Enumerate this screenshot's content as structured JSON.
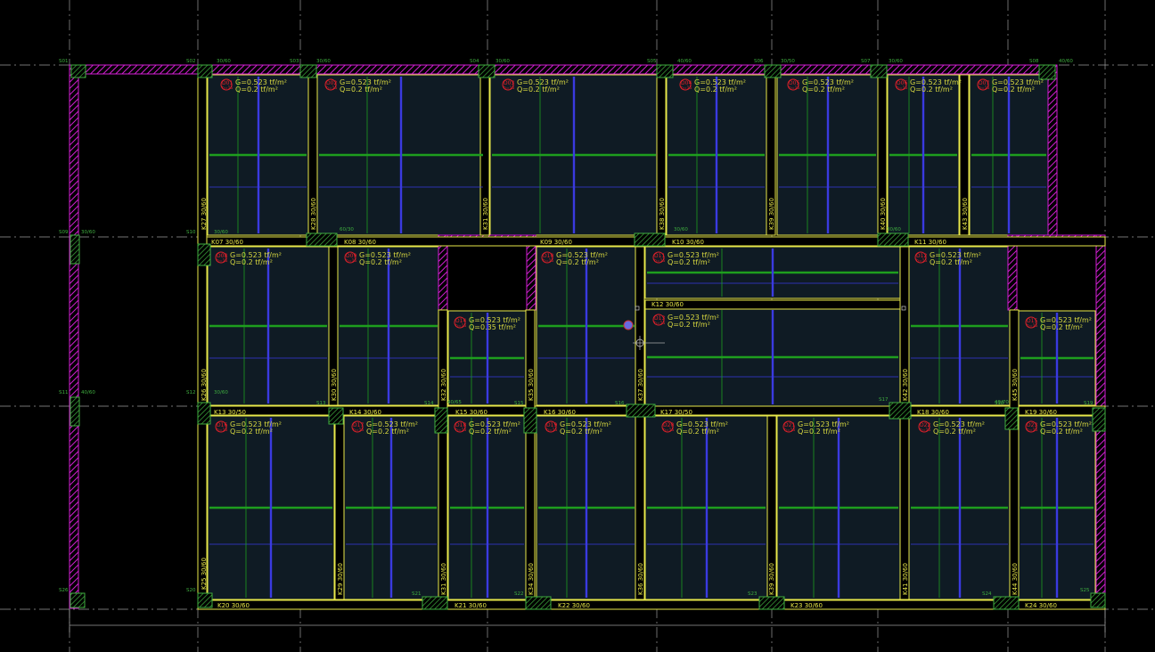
{
  "drawing": {
    "colors": {
      "background": "#000000",
      "grid": "#9a9a9a",
      "slab_fill": "#0f1b24",
      "beam": "#e8e84a",
      "column": "#3fae3f",
      "wall": "#d21ed2",
      "load_text": "#d8d840",
      "slab_tag": "#e0202a",
      "moment_green": "#1e9e1e",
      "moment_blue": "#3a3ae0",
      "label": "#e8e84a"
    },
    "slab_panels": [
      {
        "id": "D01",
        "g": "G=0.523 tf/m²",
        "q": "Q=0.2 tf/m²"
      },
      {
        "id": "D02",
        "g": "G=0.523 tf/m²",
        "q": "Q=0.2 tf/m²"
      },
      {
        "id": "D03",
        "g": "G=0.523 tf/m²",
        "q": "Q=0.2 tf/m²"
      },
      {
        "id": "D04",
        "g": "G=0.523 tf/m²",
        "q": "Q=0.2 tf/m²"
      },
      {
        "id": "D05",
        "g": "G=0.523 tf/m²",
        "q": "Q=0.2 tf/m²"
      },
      {
        "id": "D06",
        "g": "G=0.523 tf/m²",
        "q": "Q=0.2 tf/m²"
      },
      {
        "id": "D07",
        "g": "G=0.523 tf/m²",
        "q": "Q=0.2 tf/m²"
      },
      {
        "id": "D08",
        "g": "G=0.523 tf/m²",
        "q": "Q=0.2 tf/m²"
      },
      {
        "id": "D09",
        "g": "G=0.523 tf/m²",
        "q": "Q=0.2 tf/m²"
      },
      {
        "id": "D10",
        "g": "G=0.523 tf/m²",
        "q": "Q=0.2 tf/m²"
      },
      {
        "id": "D11",
        "g": "G=0.523 tf/m²",
        "q": "Q=0.2 tf/m²"
      },
      {
        "id": "D12",
        "g": "G=0.523 tf/m²",
        "q": "Q=0.2 tf/m²"
      },
      {
        "id": "D13",
        "g": "G=0.523 tf/m²",
        "q": "Q=0.2 tf/m²"
      },
      {
        "id": "D14",
        "g": "G=0.523 tf/m²",
        "q": "Q=0.35 tf/m²"
      },
      {
        "id": "D15",
        "g": "G=0.523 tf/m²",
        "q": "Q=0.2 tf/m²"
      },
      {
        "id": "D16",
        "g": "G=0.523 tf/m²",
        "q": "Q=0.2 tf/m²"
      },
      {
        "id": "D17",
        "g": "G=0.523 tf/m²",
        "q": "Q=0.2 tf/m²"
      },
      {
        "id": "D18",
        "g": "G=0.523 tf/m²",
        "q": "Q=0.2 tf/m²"
      },
      {
        "id": "D19",
        "g": "G=0.523 tf/m²",
        "q": "Q=0.2 tf/m²"
      },
      {
        "id": "D20",
        "g": "G=0.523 tf/m²",
        "q": "Q=0.2 tf/m²"
      },
      {
        "id": "D21",
        "g": "G=0.523 tf/m²",
        "q": "Q=0.2 tf/m²"
      },
      {
        "id": "D22",
        "g": "G=0.523 tf/m²",
        "q": "Q=0.2 tf/m²"
      },
      {
        "id": "D23",
        "g": "G=0.523 tf/m²",
        "q": "Q=0.2 tf/m²"
      }
    ],
    "beam_labels": [
      "K07 30/60",
      "K08 30/60",
      "K09 30/60",
      "K10 30/60",
      "K11 30/60",
      "K12 30/60",
      "K13 30/50",
      "K14 30/60",
      "K15 30/60",
      "K16 30/60",
      "K17 30/50",
      "K18 30/60",
      "K19 30/60",
      "K20 30/60",
      "K21 30/60",
      "K22 30/60",
      "K23 30/60",
      "K24 30/60",
      "K27 30/60",
      "K28 30/60",
      "K31 30/60",
      "K38 30/60",
      "K39 30/60",
      "K40 30/60",
      "K43 30/60",
      "K26 30/60",
      "K30 30/60",
      "K32 30/60",
      "K35 30/60",
      "K37 30/60",
      "K42 30/60",
      "K45 30/60",
      "K25 30/60",
      "K29 30/60",
      "K31 30/60",
      "K34 30/60",
      "K36 30/60",
      "K39 30/60",
      "K41 30/60",
      "K44 30/60"
    ],
    "column_labels": [
      "S01",
      "S02",
      "S03",
      "S04",
      "S05",
      "S06",
      "S07",
      "S08",
      "S09",
      "S10",
      "S11",
      "S12",
      "S13",
      "S14",
      "S15",
      "S16",
      "S17",
      "S18",
      "S19",
      "S20",
      "S21",
      "S22",
      "S23",
      "S24",
      "S25",
      "S26"
    ],
    "column_dims": [
      "40/60",
      "30/60",
      "30/60",
      "30/60",
      "40/60",
      "30/50",
      "30/60",
      "30/60",
      "30/60",
      "60/30",
      "30/60",
      "30/60",
      "40/65",
      "40/70",
      "40/60",
      "30/60"
    ]
  }
}
